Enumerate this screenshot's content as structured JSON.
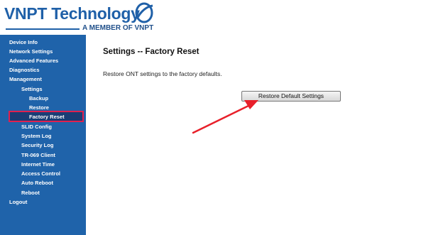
{
  "logo": {
    "wordmark": "VNPT Technology",
    "tagline": "A MEMBER OF VNPT"
  },
  "sidebar": {
    "items": [
      {
        "label": "Device Info"
      },
      {
        "label": "Network Settings"
      },
      {
        "label": "Advanced Features"
      },
      {
        "label": "Diagnostics"
      },
      {
        "label": "Management"
      },
      {
        "label": "Settings"
      },
      {
        "label": "Backup"
      },
      {
        "label": "Restore"
      },
      {
        "label": "Factory Reset",
        "active": true
      },
      {
        "label": "SLID Config"
      },
      {
        "label": "System Log"
      },
      {
        "label": "Security Log"
      },
      {
        "label": "TR-069 Client"
      },
      {
        "label": "Internet Time"
      },
      {
        "label": "Access Control"
      },
      {
        "label": "Auto Reboot"
      },
      {
        "label": "Reboot"
      },
      {
        "label": "Logout"
      }
    ]
  },
  "main": {
    "title": "Settings -- Factory Reset",
    "description": "Restore ONT settings to the factory defaults.",
    "restore_button_label": "Restore Default Settings"
  },
  "annotations": {
    "highlight_color": "#e0204f",
    "arrow_color": "#e8202a",
    "arrow_target": "restore-button"
  },
  "colors": {
    "sidebar_bg": "#1f63aa",
    "brand": "#1f60a8"
  }
}
